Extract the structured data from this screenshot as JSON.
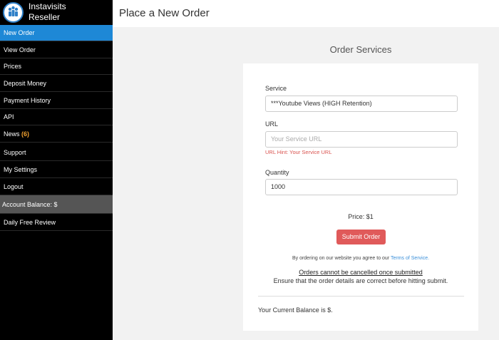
{
  "brand": {
    "line1": "Instavisits",
    "line2": "Reseller"
  },
  "sidebar": {
    "items": [
      {
        "label": "New Order"
      },
      {
        "label": "View Order"
      },
      {
        "label": "Prices"
      },
      {
        "label": "Deposit Money"
      },
      {
        "label": "Payment History"
      },
      {
        "label": "API"
      },
      {
        "label": "News",
        "badge": "(6)"
      },
      {
        "label": "Support"
      },
      {
        "label": "My Settings"
      },
      {
        "label": "Logout"
      },
      {
        "label": "Account Balance: $"
      },
      {
        "label": "Daily Free Review"
      }
    ]
  },
  "header": {
    "title": "Place a New Order"
  },
  "form": {
    "heading": "Order Services",
    "service_label": "Service",
    "service_value": "***Youtube Views (HIGH Retention)",
    "url_label": "URL",
    "url_placeholder": "Your Service URL",
    "url_hint": "URL Hint: Your Service URL",
    "quantity_label": "Quantity",
    "quantity_value": "1000",
    "price_text": "Price: $1",
    "submit_label": "Submit Order",
    "terms_prefix": "By ordering on our website you agree to our ",
    "terms_link": "Terms of Service.",
    "warning_title": "Orders cannot be cancelled once submitted",
    "warning_text": "Ensure that the order details are correct before hitting submit.",
    "balance_text": "Your Current Balance is $."
  },
  "colors": {
    "active_nav": "#1e88d6",
    "submit": "#e05a5a",
    "hint": "#d9534f",
    "badge": "#f0a030",
    "link": "#3a8fd9"
  }
}
